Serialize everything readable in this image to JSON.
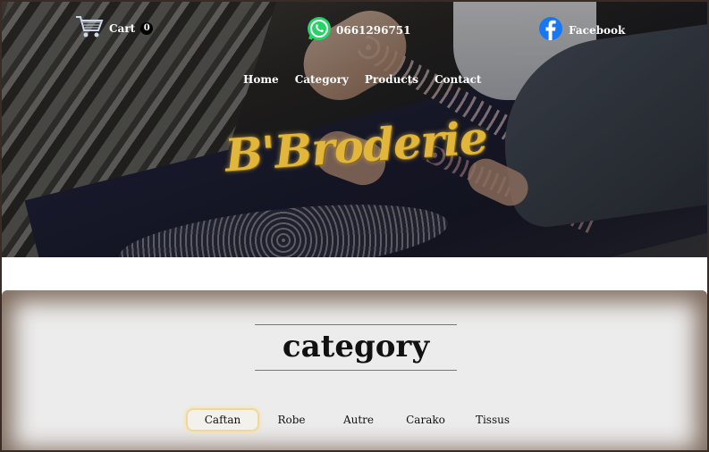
{
  "header": {
    "cart_label": "Cart",
    "cart_count": "0",
    "phone": "0661296751",
    "facebook_label": "Facebook"
  },
  "nav": {
    "items": [
      "Home",
      "Category",
      "Products",
      "Contact"
    ]
  },
  "hero": {
    "logo_text": "B'Broderie"
  },
  "category": {
    "title": "category",
    "tabs": [
      "Caftan",
      "Robe",
      "Autre",
      "Carako",
      "Tissus"
    ],
    "active_tab": "Caftan"
  },
  "colors": {
    "logo_gold": "#e2b63a",
    "whatsapp_green": "#25d366",
    "facebook_blue": "#1877f2",
    "active_tab_border": "#f2d79a"
  }
}
